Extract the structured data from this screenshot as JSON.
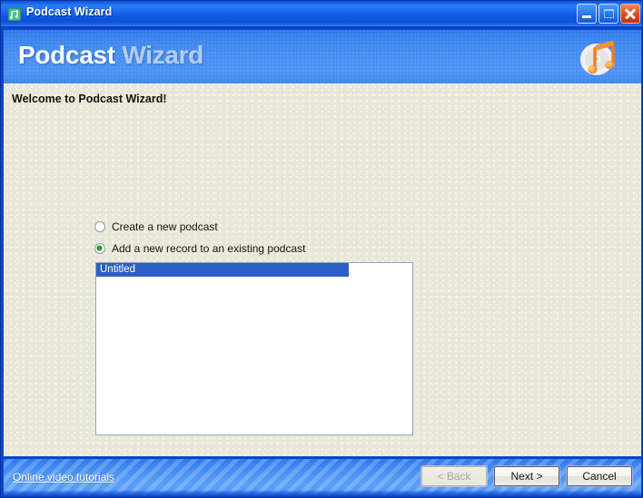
{
  "window": {
    "title": "Podcast Wizard",
    "icon": "podcast-app-icon",
    "controls": {
      "minimize": "minimize-icon",
      "maximize": "maximize-icon",
      "close": "close-icon"
    },
    "colors": {
      "titlebar_blue": "#1663EC",
      "banner_blue": "#4A90F2",
      "content_beige": "#E9E8D8",
      "footer_blue": "#4D93F3",
      "selection_blue": "#2C5FC4",
      "radio_green": "#2BA52B",
      "close_red": "#E4552A"
    }
  },
  "banner": {
    "title_bold": "Podcast",
    "title_light": "Wizard",
    "logo": "cd-music-note-logo"
  },
  "main": {
    "heading": "Welcome to Podcast Wizard!",
    "options": [
      {
        "label": "Create a new podcast",
        "selected": false
      },
      {
        "label": "Add a new record to an existing podcast",
        "selected": true
      }
    ],
    "podcast_list": [
      {
        "label": "Untitled",
        "selected": true
      }
    ]
  },
  "footer": {
    "link": "Online video tutorials",
    "buttons": [
      {
        "label": "< Back",
        "enabled": false
      },
      {
        "label": "Next >",
        "enabled": true
      },
      {
        "label": "Cancel",
        "enabled": true
      }
    ]
  }
}
